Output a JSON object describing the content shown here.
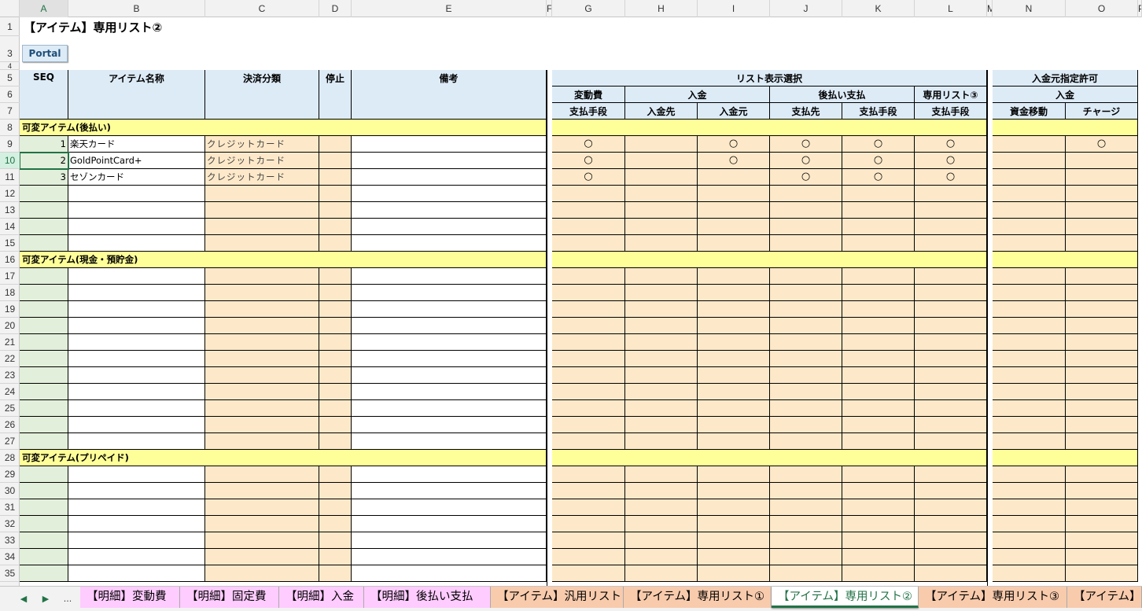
{
  "sheet": {
    "title": "【アイテム】専用リスト②",
    "portal_label": "Portal",
    "columns": [
      "A",
      "B",
      "C",
      "D",
      "E",
      "F",
      "G",
      "H",
      "I",
      "J",
      "K",
      "L",
      "M",
      "N",
      "O",
      "P"
    ],
    "row_numbers": [
      "1",
      "3",
      "4",
      "5",
      "6",
      "7",
      "8",
      "9",
      "10",
      "11",
      "12",
      "13",
      "14",
      "15",
      "16",
      "17",
      "18",
      "19",
      "20",
      "21",
      "22",
      "23",
      "24",
      "25",
      "26",
      "27",
      "28",
      "29",
      "30",
      "31",
      "32",
      "33",
      "34",
      "35"
    ],
    "selected_column": "A",
    "selected_row": "10"
  },
  "headers": {
    "seq": "SEQ",
    "item_name": "アイテム名称",
    "payment_class": "決済分類",
    "stop": "停止",
    "remarks": "備考",
    "list_display": "リスト表示選択",
    "variable_cost": "変動費",
    "deposit": "入金",
    "postpay": "後払い支払",
    "dedicated_list3": "専用リスト③",
    "pay_method": "支払手段",
    "deposit_to": "入金先",
    "deposit_from": "入金元",
    "pay_to": "支払先",
    "source_permission": "入金元指定許可",
    "fund_transfer": "資金移動",
    "charge": "チャージ"
  },
  "sections": [
    {
      "label": "可変アイテム(後払い)"
    },
    {
      "label": "可変アイテム(現金・預貯金)"
    },
    {
      "label": "可変アイテム(プリペイド)"
    }
  ],
  "items": [
    {
      "seq": "1",
      "name": "楽天カード",
      "class": "クレジットカード",
      "marks": [
        "○",
        "",
        "○",
        "○",
        "○",
        "○",
        "",
        "○"
      ]
    },
    {
      "seq": "2",
      "name": "GoldPointCard+",
      "class": "クレジットカード",
      "marks": [
        "○",
        "",
        "○",
        "○",
        "○",
        "○",
        "",
        ""
      ]
    },
    {
      "seq": "3",
      "name": "セゾンカード",
      "class": "クレジットカード",
      "marks": [
        "○",
        "",
        "",
        "○",
        "○",
        "○",
        "",
        ""
      ]
    }
  ],
  "tabs": {
    "nav_prev": "◀",
    "nav_next": "▶",
    "nav_more": "...",
    "items": [
      {
        "label": "【明細】変動費",
        "style": "pink"
      },
      {
        "label": "【明細】固定費",
        "style": "pink"
      },
      {
        "label": "【明細】入金",
        "style": "pink"
      },
      {
        "label": "【明細】後払い支払",
        "style": "pink"
      },
      {
        "label": "【アイテム】汎用リスト",
        "style": "peach"
      },
      {
        "label": "【アイテム】専用リスト①",
        "style": "peach"
      },
      {
        "label": "【アイテム】専用リスト②",
        "style": "active"
      },
      {
        "label": "【アイテム】専用リスト③",
        "style": "peach"
      },
      {
        "label": "【アイテム】ヘ",
        "style": "peach"
      }
    ]
  },
  "colors": {
    "header_blue": "#ddebf7",
    "section_yellow": "#ffff99",
    "input_peach": "#fde9c9",
    "seq_green": "#e2efda",
    "accent_green": "#217346"
  }
}
